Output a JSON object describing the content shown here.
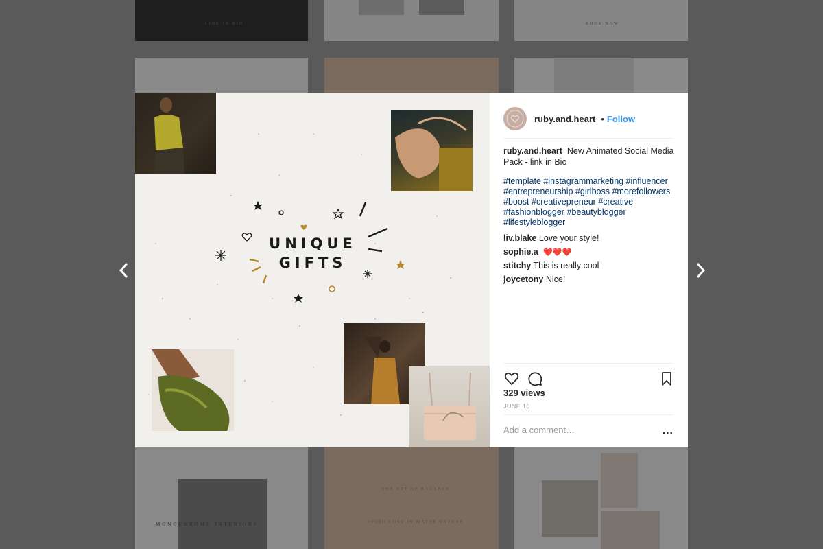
{
  "background": {
    "tile_texts": [
      "LINK IN BIO",
      "BOOK NOW",
      "MONOCHROME INTERIORS",
      "THE ART OF BALANCE",
      "AVOID LOSS IN MATTE NATURE"
    ]
  },
  "post": {
    "headline_line1": "UNIQUE",
    "headline_line2": "GIFTS"
  },
  "header": {
    "username": "ruby.and.heart",
    "separator": "•",
    "follow_label": "Follow"
  },
  "caption": {
    "username": "ruby.and.heart",
    "text": "New Animated Social Media Pack - link in Bio"
  },
  "hashtags": [
    "#template",
    "#instagrammarketing",
    "#influencer",
    "#entrepreneurship",
    "#girlboss",
    "#morefollowers",
    "#boost",
    "#creativepreneur",
    "#creative",
    "#fashionblogger",
    "#beautyblogger",
    "#lifestyleblogger"
  ],
  "comments": [
    {
      "user": "liv.blake",
      "text": "Love your style!"
    },
    {
      "user": "sophie.a",
      "text": "❤️❤️❤️"
    },
    {
      "user": "stitchy",
      "text": "This is really cool"
    },
    {
      "user": "joycetony",
      "text": "Nice!"
    }
  ],
  "stats": {
    "views": "329 views",
    "date": "JUNE 10"
  },
  "add_comment": {
    "placeholder": "Add a comment…",
    "more_label": "..."
  },
  "icons": [
    "chevron-left-icon",
    "chevron-right-icon",
    "heart-icon",
    "comment-icon",
    "bookmark-icon",
    "more-icon"
  ],
  "colors": {
    "follow": "#3897f0",
    "hashtag": "#003569",
    "gold_accent": "#b8892f"
  }
}
